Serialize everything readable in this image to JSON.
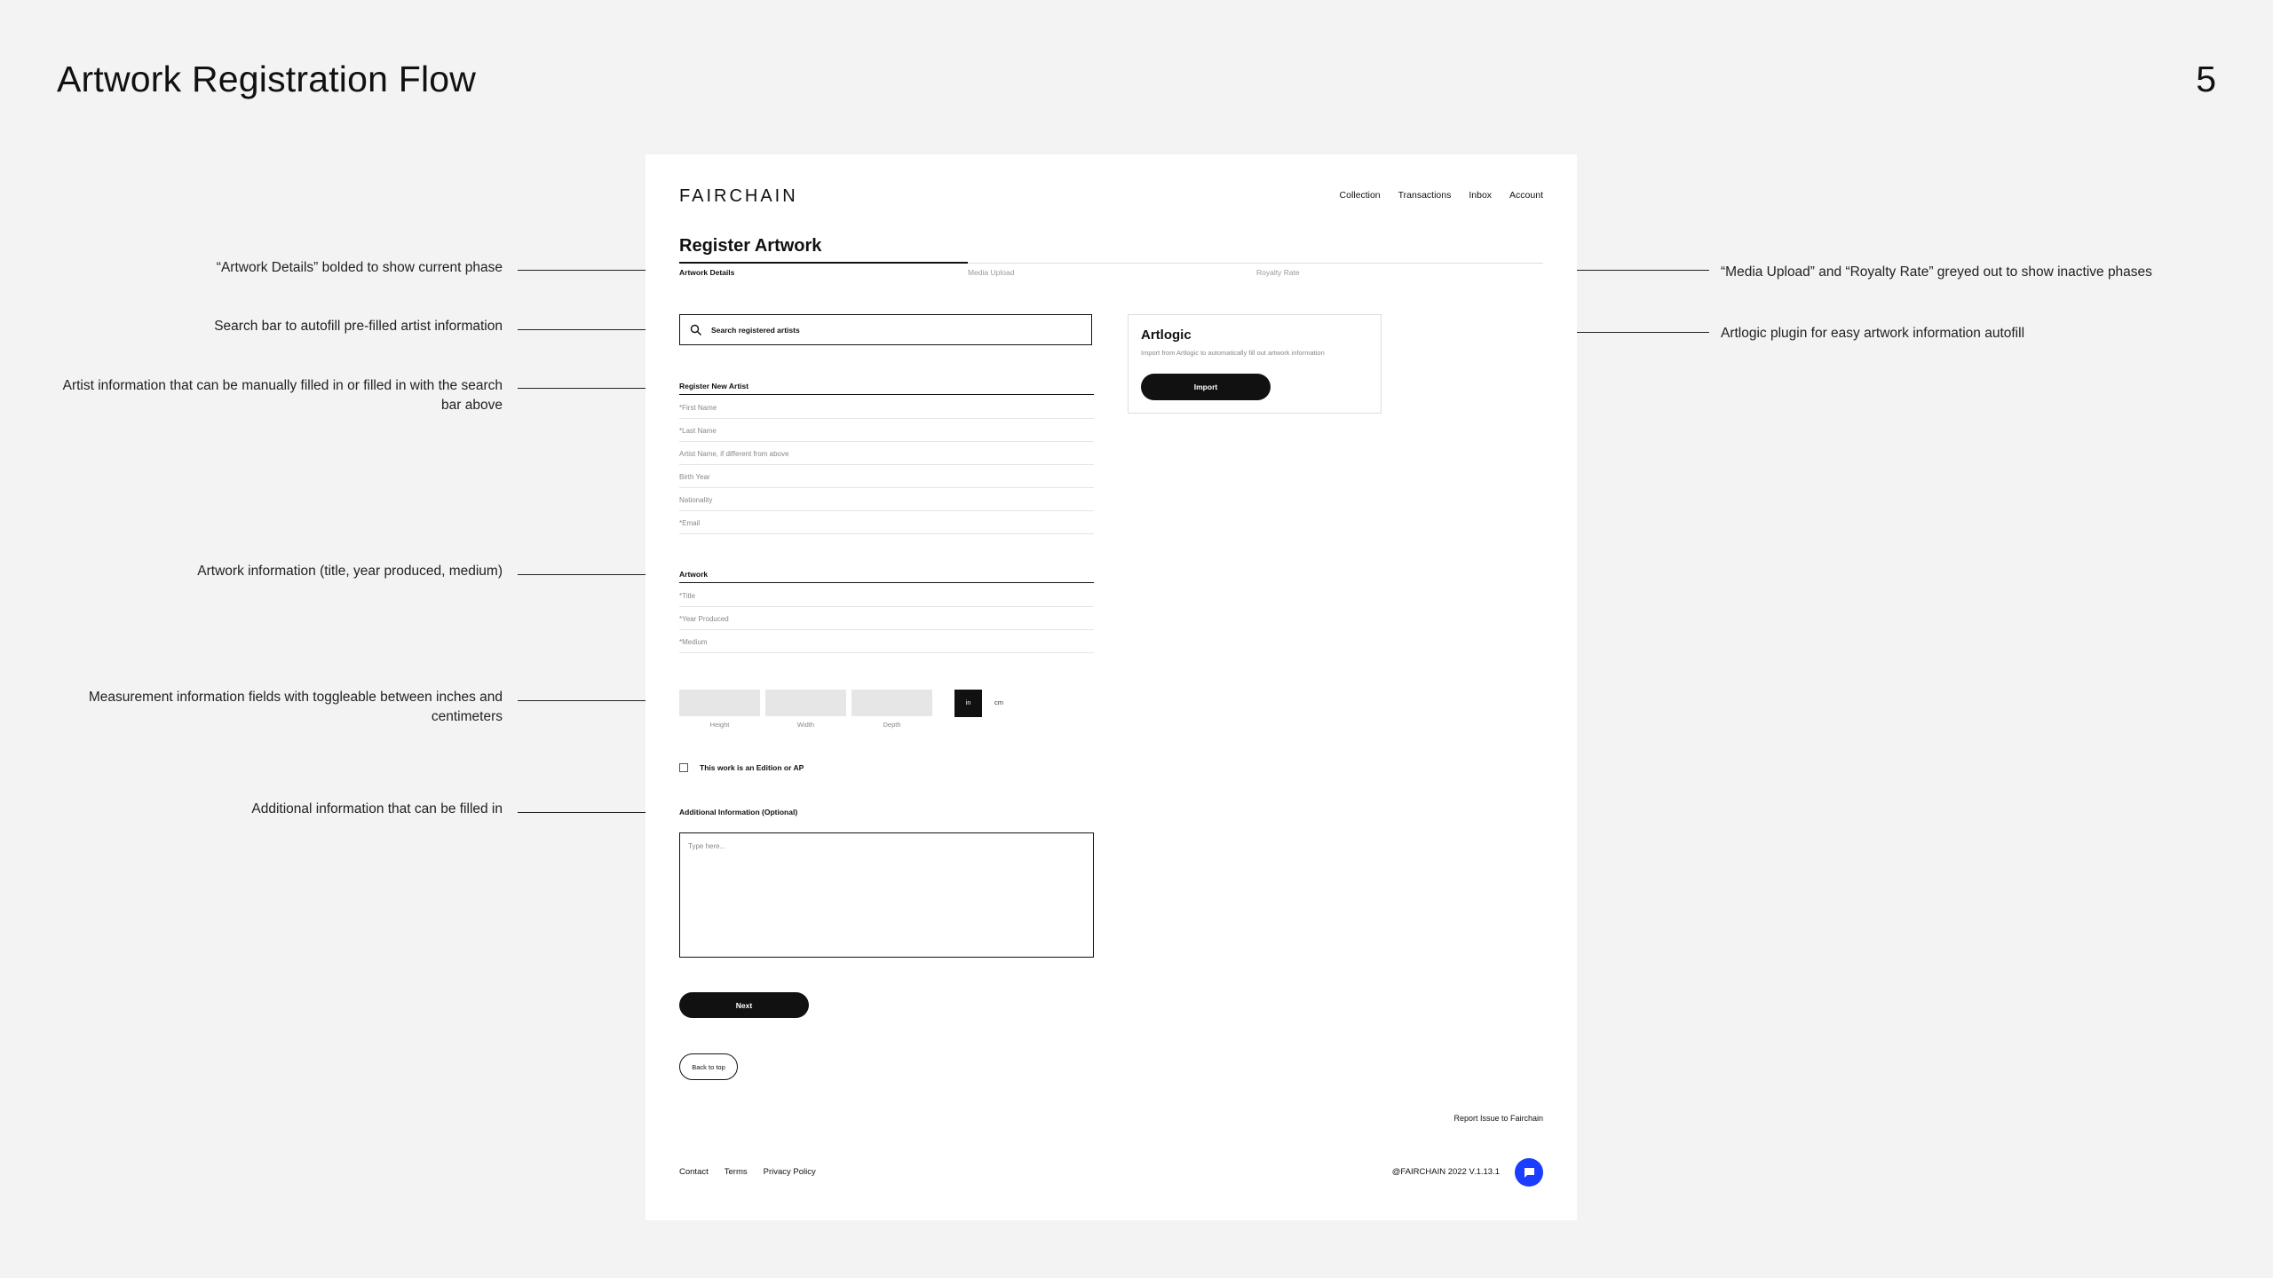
{
  "slide": {
    "title": "Artwork Registration Flow",
    "page_number": "5"
  },
  "annotations": {
    "artwork_details": "“Artwork Details” bolded to show current phase",
    "search_bar": "Search bar to autofill pre-filled artist information",
    "artist_info": "Artist information that can be manually filled in or filled in with the search bar above",
    "artwork_info": "Artwork information (title, year produced, medium)",
    "measurement": "Measurement information fields with toggleable between inches and centimeters",
    "additional": "Additional information that can be filled in",
    "inactive_phases": "“Media Upload” and “Royalty Rate” greyed out to show inactive phases",
    "artlogic": "Artlogic plugin for easy artwork information autofill"
  },
  "app": {
    "logo": "FAIRCHAIN",
    "nav": [
      "Collection",
      "Transactions",
      "Inbox",
      "Account"
    ],
    "page_title": "Register Artwork",
    "steps": [
      "Artwork Details",
      "Media Upload",
      "Royalty Rate"
    ],
    "search_placeholder": "Search registered artists",
    "artist_section": "Register New Artist",
    "artist_fields": [
      "*First Name",
      "*Last Name",
      "Artist Name, if different from above",
      "Birth Year",
      "Nationality",
      "*Email"
    ],
    "artwork_section": "Artwork",
    "artwork_fields": [
      "*Title",
      "*Year Produced",
      "*Medium"
    ],
    "measurements": [
      "Height",
      "Width",
      "Depth"
    ],
    "units": [
      "in",
      "cm"
    ],
    "edition_checkbox": "This work is an Edition or AP",
    "additional_section": "Additional Information (Optional)",
    "textarea_placeholder": "Type here...",
    "next_button": "Next",
    "back_to_top": "Back to top",
    "report_issue": "Report Issue to Fairchain",
    "footer_links": [
      "Contact",
      "Terms",
      "Privacy Policy"
    ],
    "copyright": "@FAIRCHAIN 2022 V.1.13.1",
    "artlogic": {
      "title": "Artlogic",
      "description": "Import from Artlogic to automatically fill out artwork information",
      "button": "Import"
    }
  },
  "colors": {
    "background": "#f3f3f3",
    "primary": "#111111",
    "chat": "#1a3dff"
  }
}
